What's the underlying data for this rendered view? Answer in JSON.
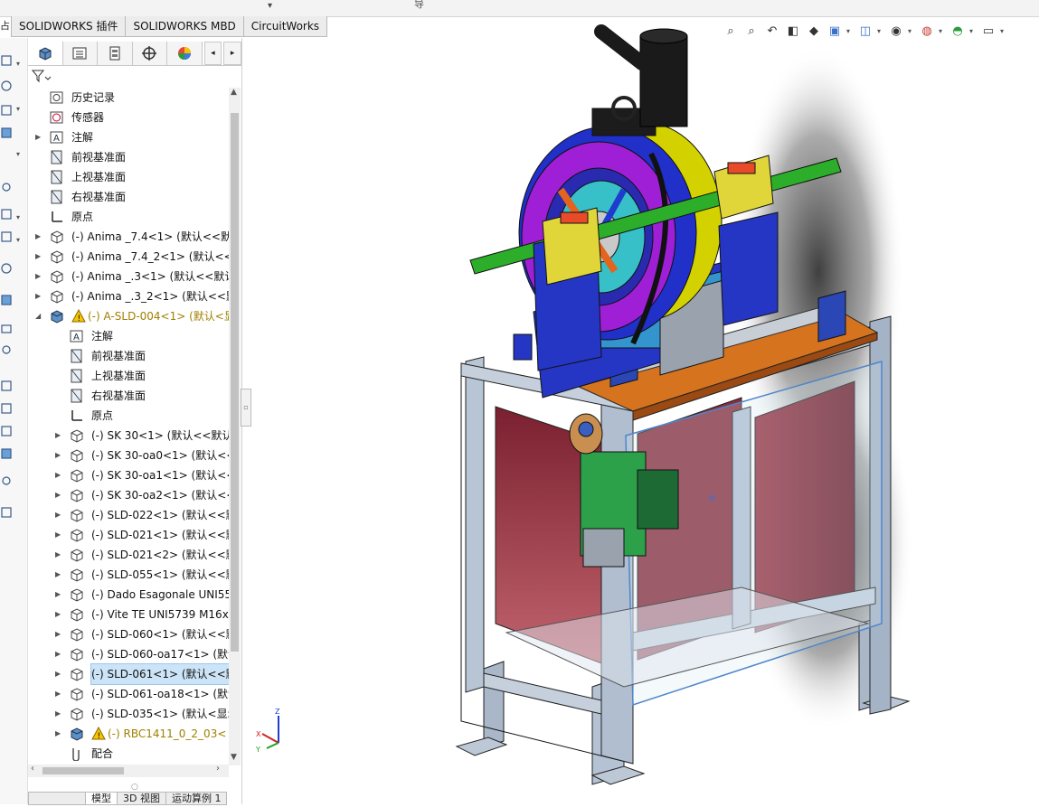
{
  "topbar": {
    "left_char": "占",
    "center_text": "导",
    "arrow": "▾"
  },
  "tabs": [
    {
      "label": "SOLIDWORKS 插件"
    },
    {
      "label": "SOLIDWORKS MBD"
    },
    {
      "label": "CircuitWorks"
    }
  ],
  "panel_tabs": [
    {
      "icon": "feature-manager-icon"
    },
    {
      "icon": "property-manager-icon"
    },
    {
      "icon": "configuration-manager-icon"
    },
    {
      "icon": "dimxpert-icon"
    },
    {
      "icon": "display-manager-icon"
    }
  ],
  "tree": [
    {
      "level": 0,
      "exp": "",
      "icon": "history-icon",
      "label": "历史记录"
    },
    {
      "level": 0,
      "exp": "",
      "icon": "sensor-icon",
      "label": "传感器"
    },
    {
      "level": 0,
      "exp": "▶",
      "icon": "annotation-icon",
      "label": "注解"
    },
    {
      "level": 0,
      "exp": "",
      "icon": "plane-icon",
      "label": "前视基准面"
    },
    {
      "level": 0,
      "exp": "",
      "icon": "plane-icon",
      "label": "上视基准面"
    },
    {
      "level": 0,
      "exp": "",
      "icon": "plane-icon",
      "label": "右视基准面"
    },
    {
      "level": 0,
      "exp": "",
      "icon": "origin-icon",
      "label": "原点"
    },
    {
      "level": 0,
      "exp": "▶",
      "icon": "part-icon",
      "label": "(-) Anima _7.4<1> (默认<<默认"
    },
    {
      "level": 0,
      "exp": "▶",
      "icon": "part-icon",
      "label": "(-) Anima _7.4_2<1> (默认<<默"
    },
    {
      "level": 0,
      "exp": "▶",
      "icon": "part-icon",
      "label": "(-) Anima _.3<1> (默认<<默认"
    },
    {
      "level": 0,
      "exp": "▶",
      "icon": "part-icon",
      "label": "(-) Anima _.3_2<1> (默认<<默"
    },
    {
      "level": 0,
      "exp": "◢",
      "icon": "assembly-icon",
      "label": "(-) A-SLD-004<1> (默认<显",
      "warn": true
    },
    {
      "level": 1,
      "exp": "",
      "icon": "annotation-icon",
      "label": "注解"
    },
    {
      "level": 1,
      "exp": "",
      "icon": "plane-icon",
      "label": "前视基准面"
    },
    {
      "level": 1,
      "exp": "",
      "icon": "plane-icon",
      "label": "上视基准面"
    },
    {
      "level": 1,
      "exp": "",
      "icon": "plane-icon",
      "label": "右视基准面"
    },
    {
      "level": 1,
      "exp": "",
      "icon": "origin-icon",
      "label": "原点"
    },
    {
      "level": 1,
      "exp": "▶",
      "icon": "part-icon",
      "label": "(-) SK 30<1> (默认<<默认"
    },
    {
      "level": 1,
      "exp": "▶",
      "icon": "part-icon",
      "label": "(-) SK 30-oa0<1> (默认<<"
    },
    {
      "level": 1,
      "exp": "▶",
      "icon": "part-icon",
      "label": "(-) SK 30-oa1<1> (默认<<"
    },
    {
      "level": 1,
      "exp": "▶",
      "icon": "part-icon",
      "label": "(-) SK 30-oa2<1> (默认<<"
    },
    {
      "level": 1,
      "exp": "▶",
      "icon": "part-icon",
      "label": "(-) SLD-022<1> (默认<<默"
    },
    {
      "level": 1,
      "exp": "▶",
      "icon": "part-icon",
      "label": "(-) SLD-021<1> (默认<<默"
    },
    {
      "level": 1,
      "exp": "▶",
      "icon": "part-icon",
      "label": "(-) SLD-021<2> (默认<<默"
    },
    {
      "level": 1,
      "exp": "▶",
      "icon": "part-icon",
      "label": "(-) SLD-055<1> (默认<<默"
    },
    {
      "level": 1,
      "exp": "▶",
      "icon": "part-icon",
      "label": "(-) Dado Esagonale UNI55"
    },
    {
      "level": 1,
      "exp": "▶",
      "icon": "part-icon",
      "label": "(-) Vite TE UNI5739 M16x"
    },
    {
      "level": 1,
      "exp": "▶",
      "icon": "part-icon",
      "label": "(-) SLD-060<1> (默认<<默"
    },
    {
      "level": 1,
      "exp": "▶",
      "icon": "part-icon",
      "label": "(-) SLD-060-oa17<1> (默认"
    },
    {
      "level": 1,
      "exp": "▶",
      "icon": "part-icon",
      "label": "(-) SLD-061<1> (默认<<默",
      "selected": true
    },
    {
      "level": 1,
      "exp": "▶",
      "icon": "part-icon",
      "label": "(-) SLD-061-oa18<1> (默认"
    },
    {
      "level": 1,
      "exp": "▶",
      "icon": "part-icon",
      "label": "(-) SLD-035<1> (默认<显示"
    },
    {
      "level": 1,
      "exp": "▶",
      "icon": "assembly-icon",
      "label": "(-) RBC1411_0_2_03<",
      "warn": true
    },
    {
      "level": 1,
      "exp": "",
      "icon": "mate-icon",
      "label": "配合"
    }
  ],
  "bottom_tabs": [
    {
      "label": ""
    },
    {
      "label": "模型"
    },
    {
      "label": "3D 视图"
    },
    {
      "label": "运动算例 1"
    }
  ],
  "heads_up_toolbar": [
    {
      "icon": "zoom-to-fit-icon"
    },
    {
      "icon": "zoom-to-area-icon"
    },
    {
      "icon": "previous-view-icon"
    },
    {
      "icon": "section-view-icon"
    },
    {
      "icon": "dynamic-annotation-icon"
    },
    {
      "icon": "view-orientation-icon"
    },
    {
      "icon": "display-style-icon"
    },
    {
      "icon": "hide-show-items-icon"
    },
    {
      "icon": "edit-appearance-icon"
    },
    {
      "icon": "apply-scene-icon"
    },
    {
      "icon": "view-settings-icon"
    }
  ],
  "triad": {
    "x": "X",
    "y": "Y",
    "z": "Z"
  },
  "colors": {
    "selection": "#cce4f7",
    "warning": "#e6b800",
    "ring": "#9f1fd6",
    "frame": "#a8b4c6",
    "panel_red": "#8e2a35"
  }
}
